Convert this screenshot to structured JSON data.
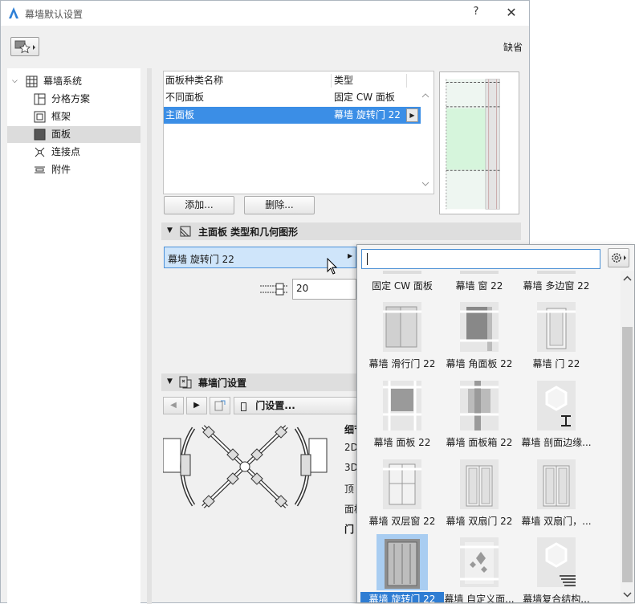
{
  "window": {
    "title": "幕墙默认设置",
    "help": "?",
    "close": "✕",
    "default_label": "缺省"
  },
  "tree": {
    "root": "幕墙系统",
    "items": [
      {
        "label": "分格方案",
        "icon": "grid-scheme-icon"
      },
      {
        "label": "框架",
        "icon": "frame-icon"
      },
      {
        "label": "面板",
        "icon": "panel-icon",
        "selected": true
      },
      {
        "label": "连接点",
        "icon": "junction-icon"
      },
      {
        "label": "附件",
        "icon": "accessory-icon"
      }
    ]
  },
  "panel_list": {
    "columns": [
      "面板种类名称",
      "类型"
    ],
    "rows": [
      {
        "name": "不同面板",
        "type": "固定 CW 面板"
      },
      {
        "name": "主面板",
        "type": "幕墙 旋转门 22",
        "selected": true
      }
    ],
    "add": "添加...",
    "delete": "删除..."
  },
  "section_type": {
    "title": "主面板 类型和几何图形",
    "selected_type": "幕墙 旋转门 22",
    "thickness": "20"
  },
  "section_door": {
    "title": "幕墙门设置",
    "door_settings": "门设置...",
    "side_labels": [
      "细节",
      "2D",
      "3D",
      "顶",
      "面板",
      "门"
    ]
  },
  "popup": {
    "search_value": "",
    "tiles": [
      {
        "label": "固定 CW 面板",
        "thumb": "fixed"
      },
      {
        "label": "幕墙 窗 22",
        "thumb": "window"
      },
      {
        "label": "幕墙 多边窗 22",
        "thumb": "poly"
      },
      {
        "label": "幕墙 滑行门 22",
        "thumb": "sliding"
      },
      {
        "label": "幕墙 角面板 22",
        "thumb": "corner"
      },
      {
        "label": "幕墙 门 22",
        "thumb": "door"
      },
      {
        "label": "幕墙 面板 22",
        "thumb": "panel"
      },
      {
        "label": "幕墙 面板箱 22",
        "thumb": "box"
      },
      {
        "label": "幕墙 剖面边缘...",
        "thumb": "hexprofile"
      },
      {
        "label": "幕墙 双层窗 22",
        "thumb": "dblwindow"
      },
      {
        "label": "幕墙 双扇门 22",
        "thumb": "dbldoor"
      },
      {
        "label": "幕墙 双扇门，...",
        "thumb": "dbldoor2"
      },
      {
        "label": "幕墙 旋转门 22",
        "thumb": "revolving",
        "selected": true
      },
      {
        "label": "幕墙 自定义面...",
        "thumb": "custom"
      },
      {
        "label": "幕墙复合结构...",
        "thumb": "hexcomposite"
      }
    ]
  },
  "colors": {
    "accent": "#3b8ee6",
    "selection_popup": "#2f7dd3",
    "glass": "#d6f5dc"
  }
}
